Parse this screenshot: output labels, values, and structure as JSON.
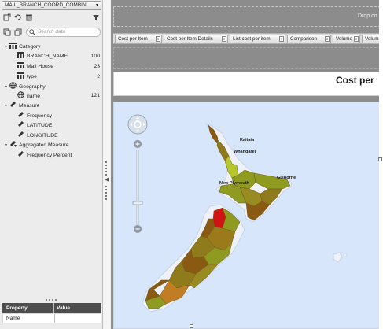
{
  "datasource": {
    "label": "MAIL_BRANCH_COORD_COMBIN",
    "icon": "chevron-down-icon"
  },
  "toolbar": {
    "icons": [
      "new-report-icon",
      "refresh-icon",
      "delete-icon",
      "filter-icon",
      "expand-all-icon",
      "collapse-all-icon"
    ]
  },
  "search": {
    "placeholder": "Search data",
    "icon": "search-icon"
  },
  "tree": {
    "category": {
      "label": "Category",
      "icon": "hierarchy-icon"
    },
    "category_items": [
      {
        "label": "BRANCH_NAME",
        "count": "100"
      },
      {
        "label": "Mail House",
        "count": "23"
      },
      {
        "label": "type",
        "count": "2"
      }
    ],
    "geography": {
      "label": "Geography",
      "icon": "globe-icon"
    },
    "geography_items": [
      {
        "label": "name",
        "count": "121"
      }
    ],
    "measure": {
      "label": "Measure",
      "icon": "ruler-icon"
    },
    "measure_items": [
      {
        "label": "Frequency"
      },
      {
        "label": "LATITUDE"
      },
      {
        "label": "LONGITUDE"
      }
    ],
    "aggregated": {
      "label": "Aggregated Measure",
      "icon": "ruler-sum-icon"
    },
    "aggregated_items": [
      {
        "label": "Frequency Percent"
      }
    ]
  },
  "properties": {
    "col1": "Property",
    "col2": "Value",
    "row1": "Name"
  },
  "canvas": {
    "drop_top": "Drop co",
    "tabs": [
      {
        "label": "Cost per Item"
      },
      {
        "label": "Cost per Item Details"
      },
      {
        "label": "List:cost per item"
      },
      {
        "label": "Comparison"
      },
      {
        "label": "Volume"
      },
      {
        "label": "Volum"
      }
    ],
    "title": "Cost per"
  },
  "map": {
    "labels": {
      "a": "Kaitaia",
      "b": "Whangarei",
      "c": "New Plymouth",
      "d": "Gisborne"
    },
    "colors": {
      "sea": "#d7e6fa",
      "halo": "#eef2f8",
      "dark": "#8a5a12",
      "olive": "#8f9a20",
      "lime": "#b5c72a",
      "red": "#d01313",
      "orange": "#c17d24"
    }
  }
}
